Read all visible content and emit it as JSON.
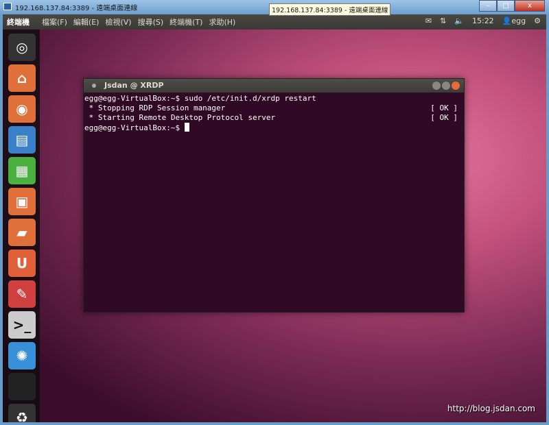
{
  "window": {
    "title": "192.168.137.84:3389 - 遠端桌面連線",
    "minimize": "–",
    "maximize": "□",
    "close": "x"
  },
  "panel": {
    "app_name": "終端機",
    "menu": [
      "檔案(F)",
      "編輯(E)",
      "檢視(V)",
      "搜尋(S)",
      "終端機(T)",
      "求助(H)"
    ],
    "tray": {
      "mail": "✉",
      "network": "⇅",
      "volume": "🔈",
      "time": "15:22",
      "user": "egg",
      "power": "⚙"
    }
  },
  "tooltip": "192.168.137.84:3389 - 遠端桌面連線",
  "launcher": [
    {
      "name": "dash",
      "glyph": "◎",
      "color": "#333"
    },
    {
      "name": "home-folder",
      "glyph": "⌂",
      "color": "#e0703a"
    },
    {
      "name": "firefox",
      "glyph": "◉",
      "color": "#e0703a"
    },
    {
      "name": "writer",
      "glyph": "▤",
      "color": "#3a80c8"
    },
    {
      "name": "calc",
      "glyph": "▦",
      "color": "#4ab040"
    },
    {
      "name": "impress",
      "glyph": "▣",
      "color": "#e0703a"
    },
    {
      "name": "software-center",
      "glyph": "▰",
      "color": "#e0703a"
    },
    {
      "name": "ubuntu-one",
      "glyph": "U",
      "color": "#e0603a"
    },
    {
      "name": "system-settings",
      "glyph": "✎",
      "color": "#d04040"
    },
    {
      "name": "terminal",
      "glyph": ">_",
      "color": "#ccc"
    },
    {
      "name": "shotwell",
      "glyph": "✺",
      "color": "#3a90d8"
    },
    {
      "name": "workspaces",
      "glyph": "",
      "color": "#222"
    },
    {
      "name": "trash",
      "glyph": "♻",
      "color": "#333"
    }
  ],
  "terminal": {
    "title": "Jsdan @ XRDP",
    "lines": [
      {
        "text": "egg@egg-VirtualBox:~$ sudo /etc/init.d/xrdp restart",
        "status": ""
      },
      {
        "text": " * Stopping RDP Session manager",
        "status": "[ OK ]"
      },
      {
        "text": " * Starting Remote Desktop Protocol server",
        "status": "[ OK ]"
      },
      {
        "text": "egg@egg-VirtualBox:~$ ",
        "status": ""
      }
    ]
  },
  "watermark": "http://blog.jsdan.com"
}
